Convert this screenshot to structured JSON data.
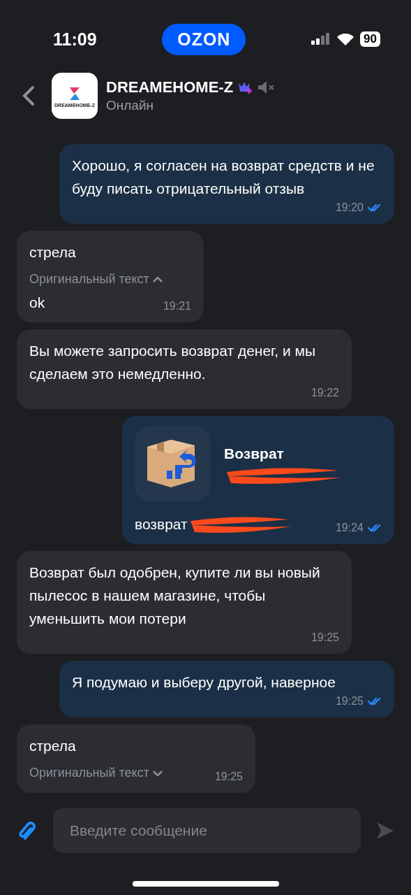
{
  "status_bar": {
    "time": "11:09",
    "app_badge": "OZON",
    "battery": "90"
  },
  "header": {
    "title": "DREAMEHOME-Z",
    "avatar_text": "DREAMEHOME-Z",
    "status": "Онлайн",
    "muted": true
  },
  "messages": [
    {
      "kind": "text",
      "outgoing": true,
      "text": "Хорошо, я согласен на возврат средств и не буду писать отрицательный отзыв",
      "time": "19:20",
      "read": true
    },
    {
      "kind": "translated",
      "outgoing": false,
      "text": "стрела",
      "toggle": "Оригинальный текст",
      "expanded": true,
      "original": "ok",
      "time": "19:21"
    },
    {
      "kind": "text",
      "outgoing": false,
      "text": "Вы можете запросить возврат денег, и мы сделаем это немедленно.",
      "time": "19:22"
    },
    {
      "kind": "card",
      "outgoing": true,
      "title": "Возврат",
      "caption": "возврат",
      "time": "19:24",
      "read": true
    },
    {
      "kind": "text",
      "outgoing": false,
      "text": "Возврат был одобрен, купите ли вы новый пылесос в нашем магазине, чтобы уменьшить мои потери",
      "time": "19:25"
    },
    {
      "kind": "text",
      "outgoing": true,
      "text": "Я подумаю и выберу другой, наверное",
      "time": "19:25",
      "read": true
    },
    {
      "kind": "translated",
      "outgoing": false,
      "text": "стрела",
      "toggle": "Оригинальный текст",
      "expanded": false,
      "time": "19:25"
    }
  ],
  "composer": {
    "placeholder": "Введите сообщение"
  }
}
